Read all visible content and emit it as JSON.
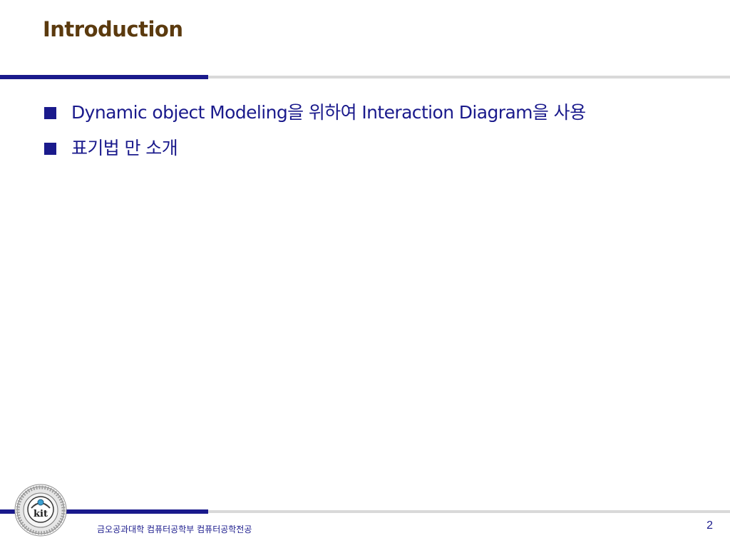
{
  "slide": {
    "title": "Introduction",
    "bullets": [
      "Dynamic object Modeling을 위하여 Interaction Diagram을 사용",
      "표기법 만 소개"
    ],
    "footer": {
      "institution_text": "금오공과대학 컴퓨터공학부 컴퓨터공학전공",
      "page_number": "2",
      "logo_text": "kit"
    },
    "colors": {
      "title": "#5b3a0e",
      "accent": "#1a1a8c",
      "rule_light": "#d9d9d9"
    }
  }
}
